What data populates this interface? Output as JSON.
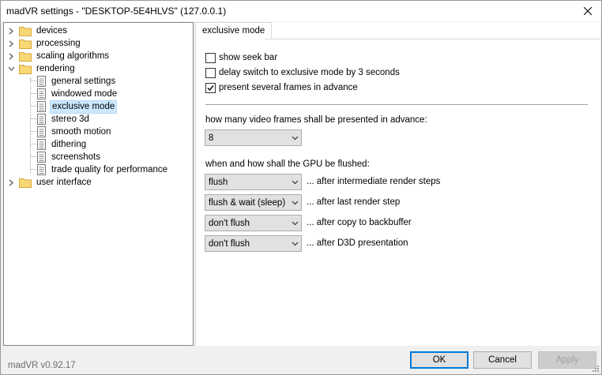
{
  "window": {
    "title": "madVR settings - \"DESKTOP-5E4HLVS\" (127.0.0.1)",
    "close_icon": "close-icon"
  },
  "tree": {
    "items": [
      {
        "label": "devices",
        "type": "folder",
        "expander": "collapsed"
      },
      {
        "label": "processing",
        "type": "folder",
        "expander": "collapsed"
      },
      {
        "label": "scaling algorithms",
        "type": "folder",
        "expander": "collapsed"
      },
      {
        "label": "rendering",
        "type": "folder",
        "expander": "expanded"
      },
      {
        "label": "general settings",
        "type": "page"
      },
      {
        "label": "windowed mode",
        "type": "page"
      },
      {
        "label": "exclusive mode",
        "type": "page",
        "selected": true
      },
      {
        "label": "stereo 3d",
        "type": "page"
      },
      {
        "label": "smooth motion",
        "type": "page"
      },
      {
        "label": "dithering",
        "type": "page"
      },
      {
        "label": "screenshots",
        "type": "page"
      },
      {
        "label": "trade quality for performance",
        "type": "page"
      },
      {
        "label": "user interface",
        "type": "folder",
        "expander": "collapsed"
      }
    ]
  },
  "tab": {
    "label": "exclusive mode"
  },
  "options": {
    "show_seek_bar": {
      "label": "show seek bar",
      "checked": false
    },
    "delay_switch": {
      "label": "delay switch to exclusive mode by 3 seconds",
      "checked": false
    },
    "present_frames": {
      "label": "present several frames in advance",
      "checked": true
    }
  },
  "frames": {
    "label": "how many video frames shall be presented in advance:",
    "value": "8"
  },
  "flush": {
    "label": "when and how shall the GPU be flushed:",
    "rows": [
      {
        "value": "flush",
        "suffix": "... after intermediate render steps"
      },
      {
        "value": "flush & wait (sleep)",
        "suffix": "... after last render step"
      },
      {
        "value": "don't flush",
        "suffix": "... after copy to backbuffer"
      },
      {
        "value": "don't flush",
        "suffix": "... after D3D presentation"
      }
    ]
  },
  "footer": {
    "version": "madVR v0.92.17",
    "ok": "OK",
    "cancel": "Cancel",
    "apply": "Apply"
  },
  "colors": {
    "selection": "#cce8ff",
    "default_button_border": "#0078d7",
    "folder_yellow": "#f8d775"
  }
}
